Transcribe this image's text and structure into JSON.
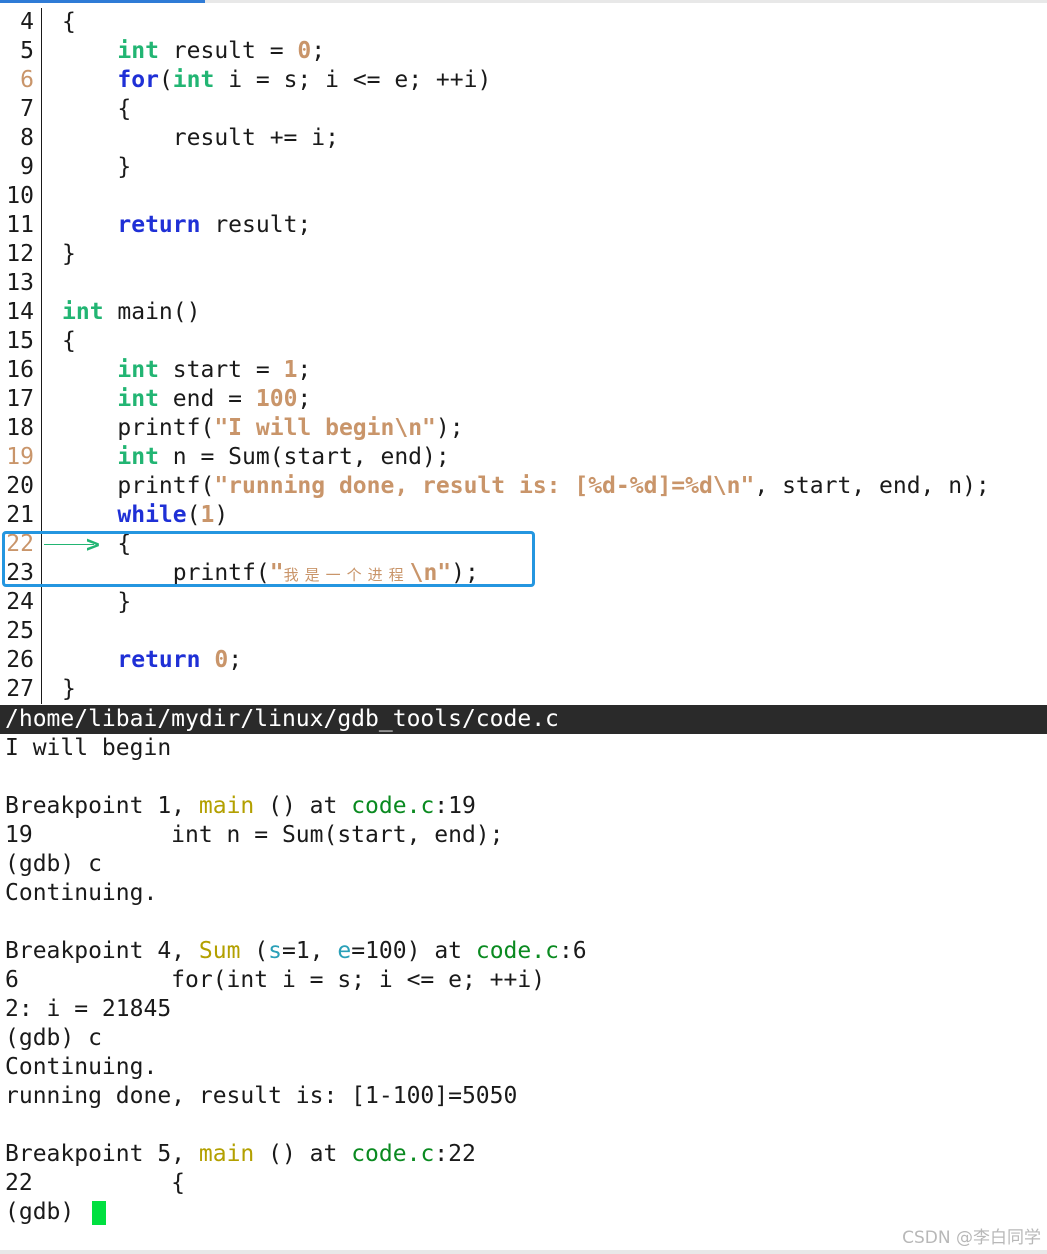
{
  "source": {
    "file_path": "/home/libai/mydir/linux/gdb_tools/code.c",
    "lines": [
      {
        "n": "4",
        "parts": [
          {
            "t": "{",
            "c": ""
          }
        ]
      },
      {
        "n": "5",
        "parts": [
          {
            "t": "    ",
            "c": ""
          },
          {
            "t": "int",
            "c": "kw"
          },
          {
            "t": " result = ",
            "c": ""
          },
          {
            "t": "0",
            "c": "num"
          },
          {
            "t": ";",
            "c": ""
          }
        ]
      },
      {
        "n": "6",
        "bp": true,
        "parts": [
          {
            "t": "    ",
            "c": ""
          },
          {
            "t": "for",
            "c": "ctl"
          },
          {
            "t": "(",
            "c": ""
          },
          {
            "t": "int",
            "c": "kw"
          },
          {
            "t": " i = s; i <= e; ++i)",
            "c": ""
          }
        ]
      },
      {
        "n": "7",
        "parts": [
          {
            "t": "    {",
            "c": ""
          }
        ]
      },
      {
        "n": "8",
        "parts": [
          {
            "t": "        result += i;",
            "c": ""
          }
        ]
      },
      {
        "n": "9",
        "parts": [
          {
            "t": "    }",
            "c": ""
          }
        ]
      },
      {
        "n": "10",
        "parts": [
          {
            "t": "",
            "c": ""
          }
        ]
      },
      {
        "n": "11",
        "parts": [
          {
            "t": "    ",
            "c": ""
          },
          {
            "t": "return",
            "c": "ctl"
          },
          {
            "t": " result;",
            "c": ""
          }
        ]
      },
      {
        "n": "12",
        "parts": [
          {
            "t": "}",
            "c": ""
          }
        ]
      },
      {
        "n": "13",
        "parts": [
          {
            "t": "",
            "c": ""
          }
        ]
      },
      {
        "n": "14",
        "parts": [
          {
            "t": "int",
            "c": "kw"
          },
          {
            "t": " main()",
            "c": ""
          }
        ]
      },
      {
        "n": "15",
        "parts": [
          {
            "t": "{",
            "c": ""
          }
        ]
      },
      {
        "n": "16",
        "parts": [
          {
            "t": "    ",
            "c": ""
          },
          {
            "t": "int",
            "c": "kw"
          },
          {
            "t": " start = ",
            "c": ""
          },
          {
            "t": "1",
            "c": "num"
          },
          {
            "t": ";",
            "c": ""
          }
        ]
      },
      {
        "n": "17",
        "parts": [
          {
            "t": "    ",
            "c": ""
          },
          {
            "t": "int",
            "c": "kw"
          },
          {
            "t": " end = ",
            "c": ""
          },
          {
            "t": "100",
            "c": "num"
          },
          {
            "t": ";",
            "c": ""
          }
        ]
      },
      {
        "n": "18",
        "parts": [
          {
            "t": "    printf(",
            "c": ""
          },
          {
            "t": "\"I will begin\\n\"",
            "c": "str"
          },
          {
            "t": ");",
            "c": ""
          }
        ]
      },
      {
        "n": "19",
        "bp": true,
        "parts": [
          {
            "t": "    ",
            "c": ""
          },
          {
            "t": "int",
            "c": "kw"
          },
          {
            "t": " n = Sum(start, end);",
            "c": ""
          }
        ]
      },
      {
        "n": "20",
        "parts": [
          {
            "t": "    printf(",
            "c": ""
          },
          {
            "t": "\"running done, result is: [%d-%d]=%d\\n\"",
            "c": "str"
          },
          {
            "t": ", start, end, n);",
            "c": ""
          }
        ]
      },
      {
        "n": "21",
        "parts": [
          {
            "t": "    ",
            "c": ""
          },
          {
            "t": "while",
            "c": "ctl"
          },
          {
            "t": "(",
            "c": ""
          },
          {
            "t": "1",
            "c": "num"
          },
          {
            "t": ")",
            "c": ""
          }
        ]
      },
      {
        "n": "22",
        "bp": true,
        "arrow": "-->",
        "parts": [
          {
            "t": "    {",
            "c": ""
          }
        ]
      },
      {
        "n": "23",
        "parts": [
          {
            "t": "        printf(",
            "c": ""
          },
          {
            "t": "\"",
            "c": "str"
          },
          {
            "t": "我是一个进程",
            "c": "str cjk"
          },
          {
            "t": "\\n\"",
            "c": "str"
          },
          {
            "t": ");",
            "c": ""
          }
        ]
      },
      {
        "n": "24",
        "parts": [
          {
            "t": "    }",
            "c": ""
          }
        ]
      },
      {
        "n": "25",
        "parts": [
          {
            "t": "",
            "c": ""
          }
        ]
      },
      {
        "n": "26",
        "parts": [
          {
            "t": "    ",
            "c": ""
          },
          {
            "t": "return",
            "c": "ctl"
          },
          {
            "t": " ",
            "c": ""
          },
          {
            "t": "0",
            "c": "num"
          },
          {
            "t": ";",
            "c": ""
          }
        ]
      },
      {
        "n": "27",
        "parts": [
          {
            "t": "}",
            "c": ""
          }
        ]
      }
    ]
  },
  "terminal": {
    "lines": [
      [
        {
          "t": "I will begin",
          "c": ""
        }
      ],
      [
        {
          "t": "",
          "c": ""
        }
      ],
      [
        {
          "t": "Breakpoint 1, ",
          "c": ""
        },
        {
          "t": "main",
          "c": "fn"
        },
        {
          "t": " () at ",
          "c": ""
        },
        {
          "t": "code.c",
          "c": "file"
        },
        {
          "t": ":19",
          "c": ""
        }
      ],
      [
        {
          "t": "19          int n = Sum(start, end);",
          "c": ""
        }
      ],
      [
        {
          "t": "(gdb) c",
          "c": ""
        }
      ],
      [
        {
          "t": "Continuing.",
          "c": ""
        }
      ],
      [
        {
          "t": "",
          "c": ""
        }
      ],
      [
        {
          "t": "Breakpoint 4, ",
          "c": ""
        },
        {
          "t": "Sum",
          "c": "fn"
        },
        {
          "t": " (",
          "c": ""
        },
        {
          "t": "s",
          "c": "arg"
        },
        {
          "t": "=1, ",
          "c": ""
        },
        {
          "t": "e",
          "c": "arg"
        },
        {
          "t": "=100) at ",
          "c": ""
        },
        {
          "t": "code.c",
          "c": "file"
        },
        {
          "t": ":6",
          "c": ""
        }
      ],
      [
        {
          "t": "6           for(int i = s; i <= e; ++i)",
          "c": ""
        }
      ],
      [
        {
          "t": "2: i = 21845",
          "c": ""
        }
      ],
      [
        {
          "t": "(gdb) c",
          "c": ""
        }
      ],
      [
        {
          "t": "Continuing.",
          "c": ""
        }
      ],
      [
        {
          "t": "running done, result is: [1-100]=5050",
          "c": ""
        }
      ],
      [
        {
          "t": "",
          "c": ""
        }
      ],
      [
        {
          "t": "Breakpoint 5, ",
          "c": ""
        },
        {
          "t": "main",
          "c": "fn"
        },
        {
          "t": " () at ",
          "c": ""
        },
        {
          "t": "code.c",
          "c": "file"
        },
        {
          "t": ":22",
          "c": ""
        }
      ],
      [
        {
          "t": "22          {",
          "c": ""
        }
      ],
      [
        {
          "t": "(gdb) ",
          "c": ""
        }
      ]
    ]
  },
  "watermark": "CSDN @李白同学",
  "colors": {
    "type_keyword": "#22b573",
    "control_keyword": "#1f30d6",
    "literal": "#c9956a",
    "function_name": "#b3a000",
    "file_name": "#0a8a20",
    "arg_name": "#2aa0b8",
    "highlight_border": "#2496e0",
    "cursor": "#00e040",
    "status_bar_bg": "#2a2a2a"
  }
}
